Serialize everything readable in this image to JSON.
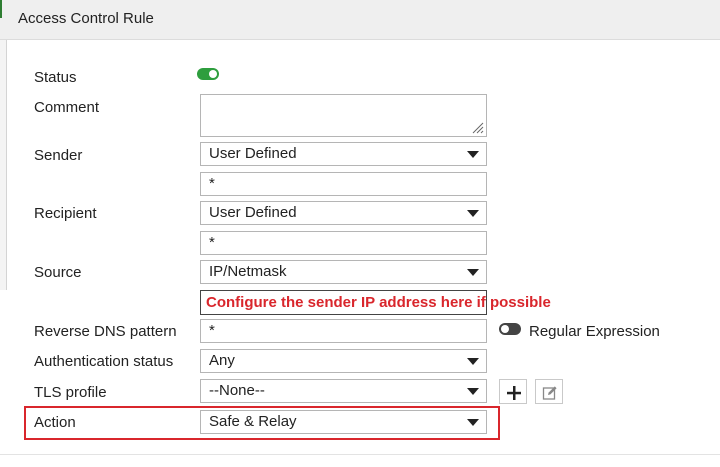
{
  "dialog": {
    "title": "Access Control Rule"
  },
  "form": {
    "status": {
      "label": "Status",
      "enabled": true
    },
    "comment": {
      "label": "Comment",
      "value": ""
    },
    "sender": {
      "label": "Sender",
      "selected": "User Defined",
      "value": "*"
    },
    "recipient": {
      "label": "Recipient",
      "selected": "User Defined",
      "value": "*"
    },
    "source": {
      "label": "Source",
      "selected": "IP/Netmask"
    },
    "annotation": {
      "text": "Configure the sender IP address here if possible",
      "color": "#d9262c"
    },
    "reverse_dns": {
      "label": "Reverse DNS pattern",
      "value": "*",
      "regex_label": "Regular Expression",
      "regex_enabled": false
    },
    "auth_status": {
      "label": "Authentication status",
      "selected": "Any"
    },
    "tls_profile": {
      "label": "TLS profile",
      "selected": "--None--"
    },
    "action": {
      "label": "Action",
      "selected": "Safe & Relay"
    }
  },
  "colors": {
    "accent_green": "#2e9e3e",
    "highlight_red": "#d9262c"
  },
  "icons": {
    "add": "plus-icon",
    "edit": "edit-icon"
  }
}
